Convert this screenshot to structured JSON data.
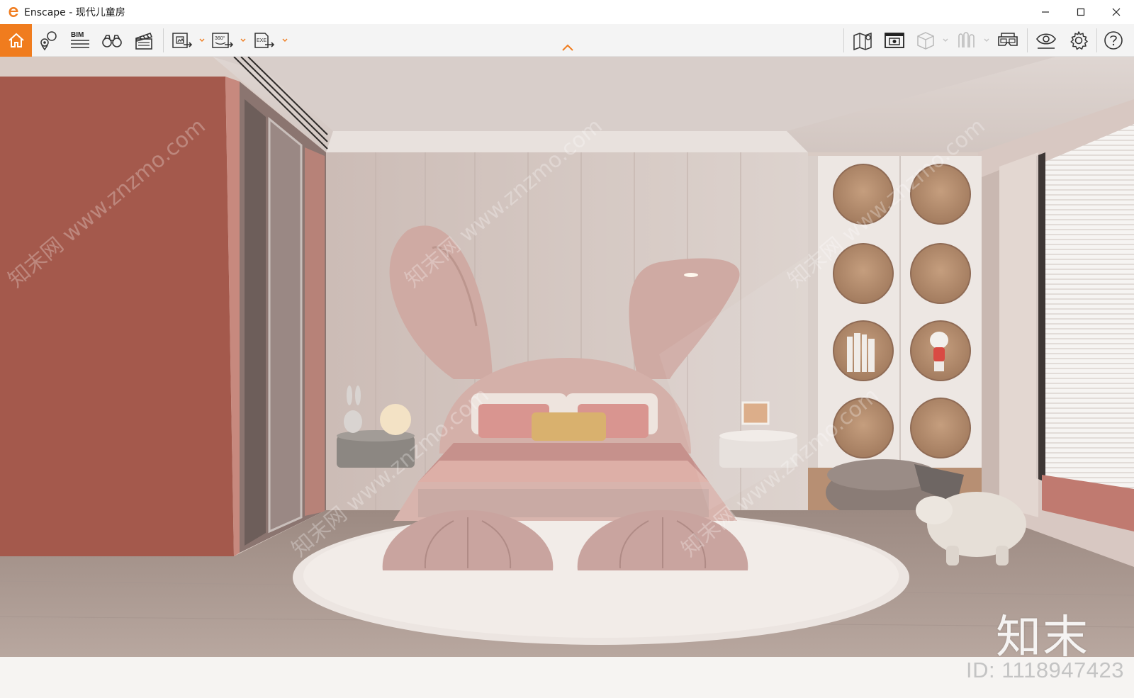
{
  "window": {
    "title": "Enscape - 现代儿童房",
    "minimize_label": "–",
    "maximize_label": "☐",
    "close_label": "✕"
  },
  "toolbar": {
    "bim_label": "BIM",
    "render_360_label": "360°",
    "exe_label": "EXE",
    "accent_color": "#f07c1e",
    "left_tools": [
      "home-icon",
      "map-pin-icon",
      "bim-icon",
      "binoculars-icon",
      "clapperboard-icon",
      "export-image-icon",
      "export-panorama-icon",
      "export-exe-icon"
    ],
    "right_tools": [
      "map-icon",
      "screenshot-icon",
      "cube-icon",
      "asset-library-icon",
      "vr-headset-icon",
      "visual-settings-icon",
      "gear-icon",
      "help-icon"
    ]
  },
  "viewport": {
    "watermark_diagonal": "知末网 www.znzmo.com",
    "watermark_logo": "知末",
    "watermark_id": "ID: 1118947423"
  }
}
